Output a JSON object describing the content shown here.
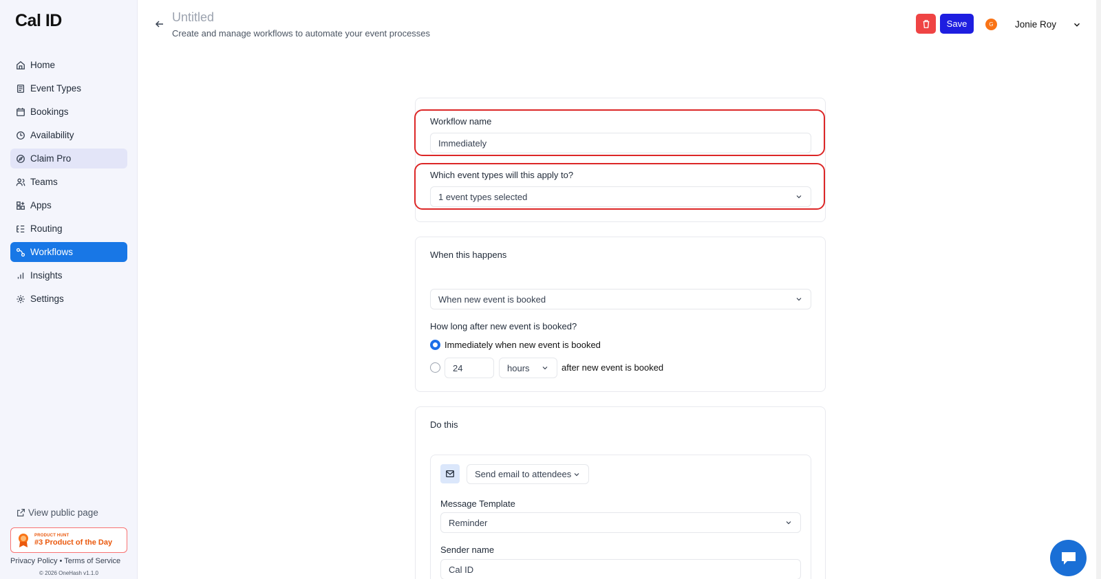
{
  "app": {
    "logo": "Cal ID"
  },
  "sidebar": {
    "items": [
      {
        "label": "Home",
        "icon": "home-icon"
      },
      {
        "label": "Event Types",
        "icon": "event-types-icon"
      },
      {
        "label": "Bookings",
        "icon": "calendar-icon"
      },
      {
        "label": "Availability",
        "icon": "clock-icon"
      },
      {
        "label": "Claim Pro",
        "icon": "compass-icon"
      },
      {
        "label": "Teams",
        "icon": "users-icon"
      },
      {
        "label": "Apps",
        "icon": "apps-grid-icon"
      },
      {
        "label": "Routing",
        "icon": "routing-list-icon"
      },
      {
        "label": "Workflows",
        "icon": "workflow-icon"
      },
      {
        "label": "Insights",
        "icon": "bar-chart-icon"
      },
      {
        "label": "Settings",
        "icon": "gear-icon"
      }
    ],
    "active": "Workflows",
    "view_public_page": "View public page",
    "product_hunt": {
      "small": "PRODUCT HUNT",
      "big": "#3 Product of the Day"
    },
    "footer": {
      "privacy": "Privacy Policy",
      "separator": "•",
      "terms": "Terms of Service",
      "copyright": "© 2026 OneHash v1.1.0"
    }
  },
  "header": {
    "title": "Untitled",
    "subtitle": "Create and manage workflows to automate your event processes",
    "save_label": "Save",
    "user": {
      "initial": "G",
      "name": "Jonie Roy"
    }
  },
  "workflow": {
    "name_label": "Workflow name",
    "name_value": "Immediately",
    "event_types_label": "Which event types will this apply to?",
    "event_types_value": "1 event types selected"
  },
  "trigger": {
    "heading": "When this happens",
    "select_value": "When new event is booked",
    "timing_label": "How long after new event is booked?",
    "option_immediate": "Immediately when new event is booked",
    "offset_value": "24",
    "offset_unit": "hours",
    "option_after_suffix": "after new event is booked",
    "selected": "immediate"
  },
  "action": {
    "heading": "Do this",
    "action_value": "Send email to attendees",
    "template_label": "Message Template",
    "template_value": "Reminder",
    "sender_label": "Sender name",
    "sender_value": "Cal ID"
  },
  "colors": {
    "accent": "#1877e6",
    "save": "#1e1ee0",
    "delete": "#ef4444",
    "highlight": "#dc2626",
    "sidebar_bg": "#f4f5fc"
  }
}
